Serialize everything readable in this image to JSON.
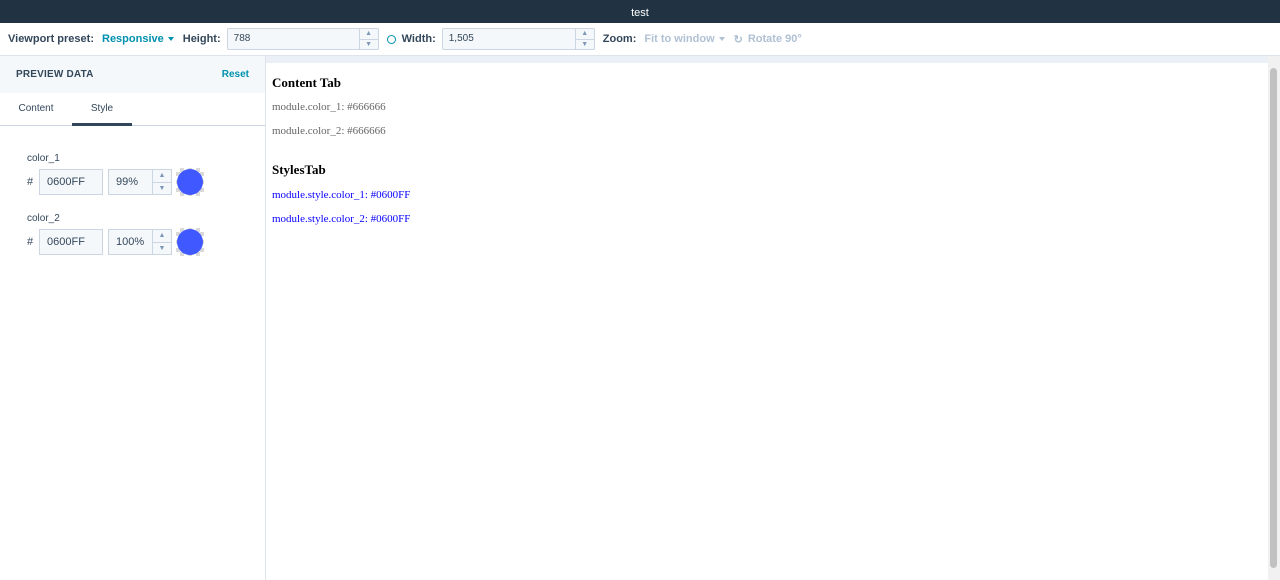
{
  "window": {
    "title": "test"
  },
  "toolbar": {
    "viewport_label": "Viewport preset:",
    "viewport_value": "Responsive",
    "height_label": "Height:",
    "height_value": "788",
    "width_label": "Width:",
    "width_value": "1,505",
    "zoom_label": "Zoom:",
    "zoom_value": "Fit to window",
    "rotate_label": "Rotate 90°"
  },
  "panel": {
    "title": "PREVIEW DATA",
    "reset_label": "Reset",
    "tabs": [
      {
        "label": "Content",
        "active": false
      },
      {
        "label": "Style",
        "active": true
      }
    ],
    "fields": [
      {
        "label": "color_1",
        "hash": "#",
        "hex": "0600FF",
        "opacity": "99%",
        "color": "#3f58ff"
      },
      {
        "label": "color_2",
        "hash": "#",
        "hex": "0600FF",
        "opacity": "100%",
        "color": "#3f58ff"
      }
    ]
  },
  "preview": {
    "content_heading": "Content Tab",
    "content_lines": [
      "module.color_1: #666666",
      "module.color_2: #666666"
    ],
    "content_color": "#666666",
    "styles_heading": "StylesTab",
    "styles_lines": [
      "module.style.color_1: #0600FF",
      "module.style.color_2: #0600FF"
    ],
    "styles_color": "#0600FF"
  }
}
